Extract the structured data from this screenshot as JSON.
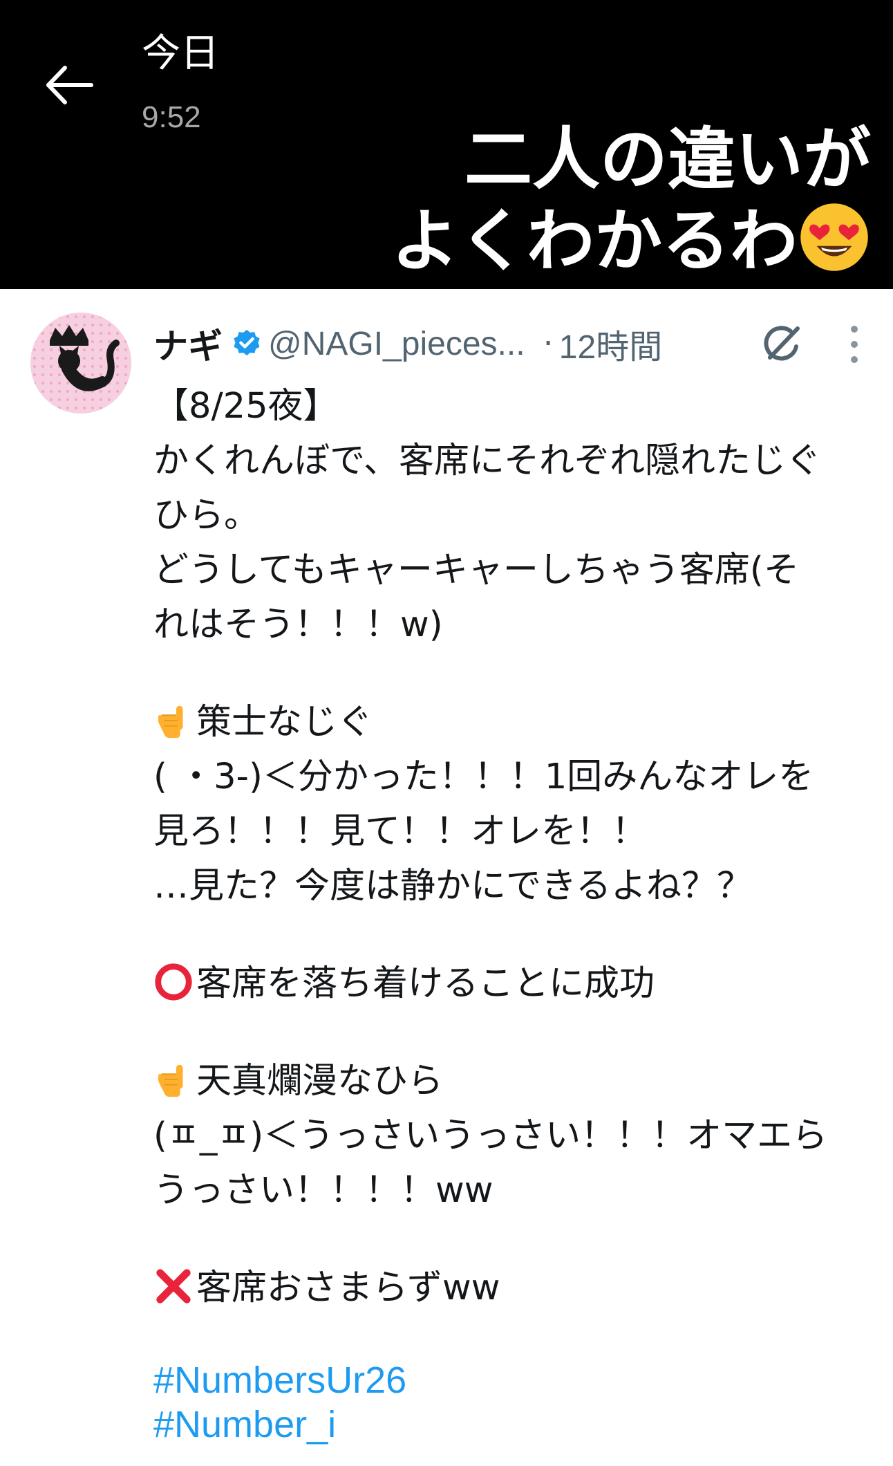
{
  "header": {
    "title": "今日",
    "time": "9:52"
  },
  "caption": {
    "line1": "二人の違いが",
    "line2": "よくわかるわ",
    "emoji": "heart-eyes-emoji"
  },
  "tweet": {
    "author": {
      "display_name": "ナギ",
      "handle": "@NAGI_pieces...",
      "verified_icon": "verified-badge-icon"
    },
    "age": "12時間",
    "separator": "·",
    "body": {
      "line1": "【8/25夜】",
      "line2": "かくれんぼで、客席にそれぞれ隠れたじぐ",
      "line3": "ひら。",
      "line4": "どうしてもキャーキャーしちゃう客席(そ",
      "line5": "れはそう！！！w)",
      "strategist_heading": "策士なじぐ",
      "strategist_line1": "( ・3-)＜分かった！！！1回みんなオレを",
      "strategist_line2": "見ろ！！！見て！！オレを！！",
      "strategist_line3": "…見た？今度は静かにできるよね？？",
      "success_line": "客席を落ち着けることに成功",
      "innocent_heading": "天真爛漫なひら",
      "innocent_line1": "(ㅍ_ㅍ)＜うっさいうっさい！！！オマエら",
      "innocent_line2": "うっさい！！！！ww",
      "fail_line": "客席おさまらずww"
    },
    "hashtags": [
      "#NumbersUr26",
      "#Number_i"
    ]
  },
  "colors": {
    "topbar": "#000000",
    "hashtag": "#1d9bf0",
    "verified": "#1d9bf0",
    "text": "#14171a",
    "secondary": "#536471"
  },
  "icons": {
    "back": "back-arrow-icon",
    "grok": "grok-icon",
    "more": "more-vertical-icon",
    "point_down": "pointing-down-emoji",
    "circle": "red-circle-emoji",
    "cross": "cross-mark-emoji"
  }
}
